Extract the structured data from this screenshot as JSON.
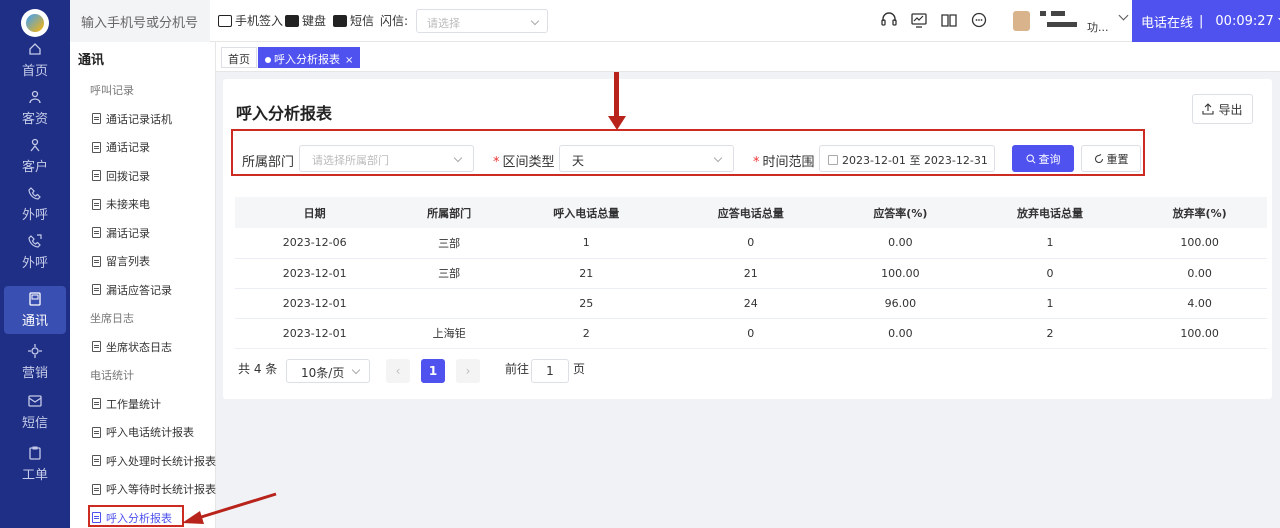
{
  "nav": {
    "items": [
      {
        "label": "首页",
        "icon": "home-icon"
      },
      {
        "label": "客资",
        "icon": "leads-icon"
      },
      {
        "label": "客户",
        "icon": "customer-icon"
      },
      {
        "label": "外呼",
        "icon": "outbound-call-icon"
      },
      {
        "label": "外呼",
        "icon": "outbound-call-alt-icon"
      },
      {
        "label": "通讯",
        "icon": "communication-icon"
      },
      {
        "label": "营销",
        "icon": "marketing-icon"
      },
      {
        "label": "短信",
        "icon": "sms-icon"
      },
      {
        "label": "工单",
        "icon": "ticket-icon"
      }
    ],
    "active_index": 5
  },
  "topbar": {
    "search_placeholder": "输入手机号或分机号",
    "phone_signin": "手机签入",
    "keyboard": "键盘",
    "sms": "短信",
    "flash_label": "闪信:",
    "flash_select_placeholder": "请选择",
    "user_name_suffix": "功...",
    "phone_status": "电话在线",
    "timer": "00:09:27"
  },
  "subside": {
    "title": "通讯",
    "groups": [
      {
        "label": "呼叫记录",
        "items": [
          "通话记录话机",
          "通话记录",
          "回拨记录",
          "未接来电",
          "漏话记录",
          "留言列表",
          "漏话应答记录"
        ]
      },
      {
        "label": "坐席日志",
        "items": [
          "坐席状态日志"
        ]
      },
      {
        "label": "电话统计",
        "items": [
          "工作量统计",
          "呼入电话统计报表",
          "呼入处理时长统计报表",
          "呼入等待时长统计报表",
          "呼入分析报表"
        ]
      }
    ]
  },
  "tabs": {
    "home": "首页",
    "active": "呼入分析报表",
    "close": "×"
  },
  "page": {
    "title": "呼入分析报表",
    "export_label": "导出"
  },
  "filters": {
    "dept_label": "所属部门",
    "dept_placeholder": "请选择所属部门",
    "interval_label": "区间类型",
    "interval_value": "天",
    "range_label": "时间范围",
    "range_start": "2023-12-01",
    "range_sep": "至",
    "range_end": "2023-12-31",
    "query_label": "查询",
    "reset_label": "重置"
  },
  "table": {
    "headers": [
      "日期",
      "所属部门",
      "呼入电话总量",
      "应答电话总量",
      "应答率(%)",
      "放弃电话总量",
      "放弃率(%)"
    ],
    "rows": [
      [
        "2023-12-06",
        "三部",
        "1",
        "0",
        "0.00",
        "1",
        "100.00"
      ],
      [
        "2023-12-01",
        "三部",
        "21",
        "21",
        "100.00",
        "0",
        "0.00"
      ],
      [
        "2023-12-01",
        "",
        "25",
        "24",
        "96.00",
        "1",
        "4.00"
      ],
      [
        "2023-12-01",
        "上海钜",
        "2",
        "0",
        "0.00",
        "2",
        "100.00"
      ]
    ]
  },
  "pagination": {
    "total": "共 4 条",
    "page_size": "10条/页",
    "current": "1",
    "goto_label": "前往",
    "goto_value": "1",
    "page_unit": "页"
  },
  "colors": {
    "nav_bg": "#1f2f86",
    "primary": "#4f52ee",
    "annotation": "#b8231b"
  }
}
